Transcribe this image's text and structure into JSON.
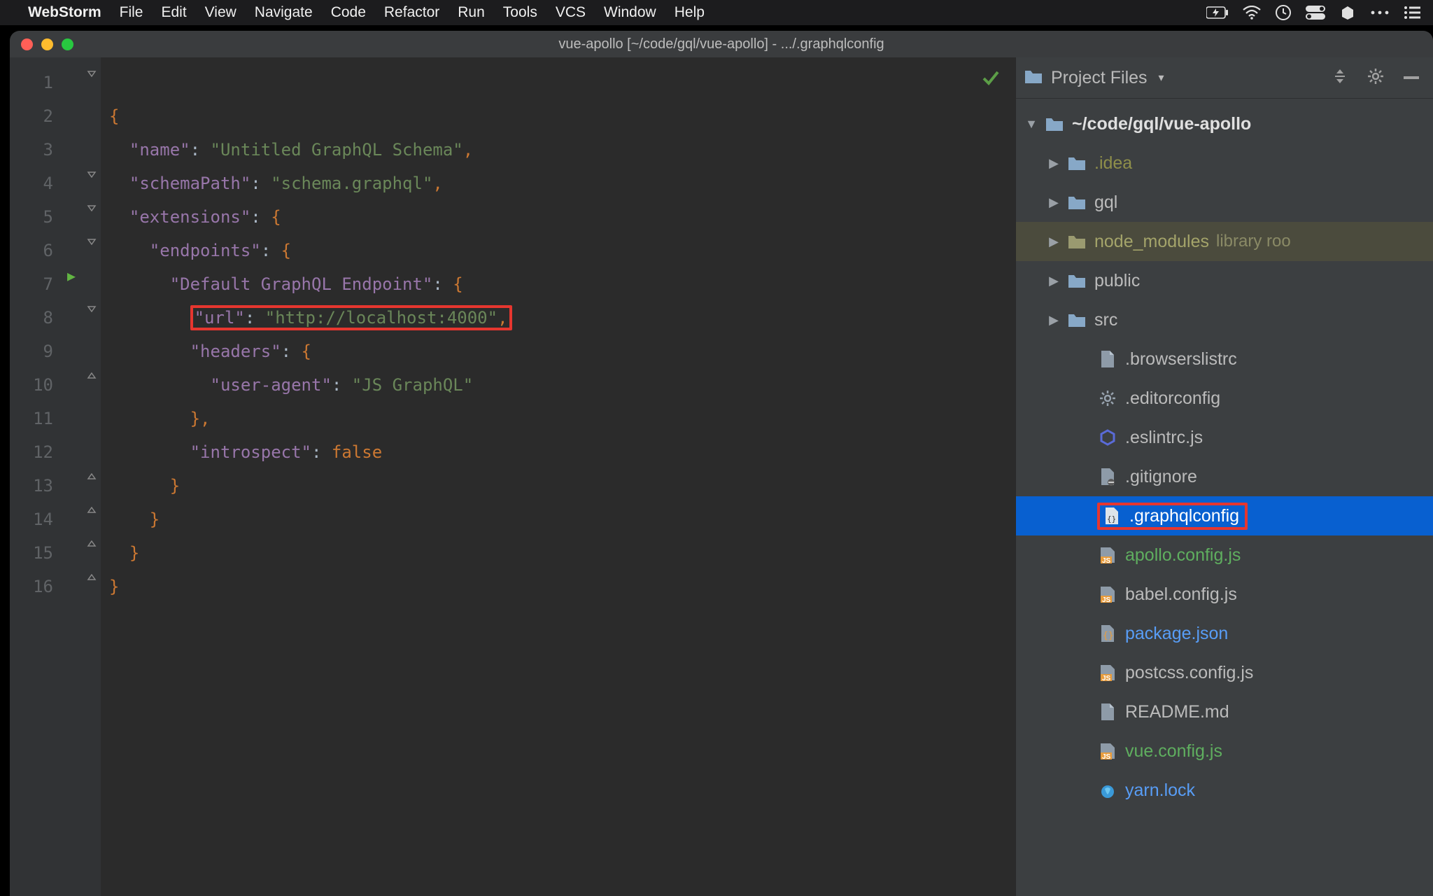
{
  "menubar": {
    "app": "WebStorm",
    "items": [
      "File",
      "Edit",
      "View",
      "Navigate",
      "Code",
      "Refactor",
      "Run",
      "Tools",
      "VCS",
      "Window",
      "Help"
    ]
  },
  "window": {
    "title": "vue-apollo [~/code/gql/vue-apollo] - .../.graphqlconfig"
  },
  "editor": {
    "line_numbers": [
      "1",
      "2",
      "3",
      "4",
      "5",
      "6",
      "7",
      "8",
      "9",
      "10",
      "11",
      "12",
      "13",
      "14",
      "15",
      "16"
    ],
    "code": {
      "l1_open": "{",
      "l2_k": "\"name\"",
      "l2_c": ": ",
      "l2_v": "\"Untitled GraphQL Schema\"",
      "l2_e": ",",
      "l3_k": "\"schemaPath\"",
      "l3_c": ": ",
      "l3_v": "\"schema.graphql\"",
      "l3_e": ",",
      "l4_k": "\"extensions\"",
      "l4_c": ": ",
      "l4_v": "{",
      "l5_k": "\"endpoints\"",
      "l5_c": ": ",
      "l5_v": "{",
      "l6_k": "\"Default GraphQL Endpoint\"",
      "l6_c": ": ",
      "l6_v": "{",
      "l7_k": "\"url\"",
      "l7_c": ": ",
      "l7_v": "\"http://localhost:4000\"",
      "l7_e": ",",
      "l8_k": "\"headers\"",
      "l8_c": ": ",
      "l8_v": "{",
      "l9_k": "\"user-agent\"",
      "l9_c": ": ",
      "l9_v": "\"JS GraphQL\"",
      "l10_close": "}",
      "l10_e": ",",
      "l11_k": "\"introspect\"",
      "l11_c": ": ",
      "l11_v": "false",
      "l12_close": "}",
      "l13_close": "}",
      "l14_close": "}",
      "l15_close": "}"
    }
  },
  "panel": {
    "title": "Project Files",
    "root": "~/code/gql/vue-apollo",
    "nodes": [
      {
        "name": ".idea",
        "type": "folder",
        "color": "olive"
      },
      {
        "name": "gql",
        "type": "folder"
      },
      {
        "name": "node_modules",
        "type": "folder",
        "suffix": "library roo",
        "excluded": true
      },
      {
        "name": "public",
        "type": "folder"
      },
      {
        "name": "src",
        "type": "folder"
      },
      {
        "name": ".browserslistrc",
        "type": "file"
      },
      {
        "name": ".editorconfig",
        "type": "file",
        "icon": "gear"
      },
      {
        "name": ".eslintrc.js",
        "type": "file",
        "icon": "eslint"
      },
      {
        "name": ".gitignore",
        "type": "file"
      },
      {
        "name": ".graphqlconfig",
        "type": "file",
        "icon": "gql",
        "selected": true
      },
      {
        "name": "apollo.config.js",
        "type": "file",
        "icon": "js",
        "color": "green"
      },
      {
        "name": "babel.config.js",
        "type": "file",
        "icon": "js"
      },
      {
        "name": "package.json",
        "type": "file",
        "icon": "json",
        "color": "blue"
      },
      {
        "name": "postcss.config.js",
        "type": "file",
        "icon": "js"
      },
      {
        "name": "README.md",
        "type": "file"
      },
      {
        "name": "vue.config.js",
        "type": "file",
        "icon": "js",
        "color": "green"
      },
      {
        "name": "yarn.lock",
        "type": "file",
        "icon": "yarn",
        "color": "blue"
      }
    ]
  }
}
